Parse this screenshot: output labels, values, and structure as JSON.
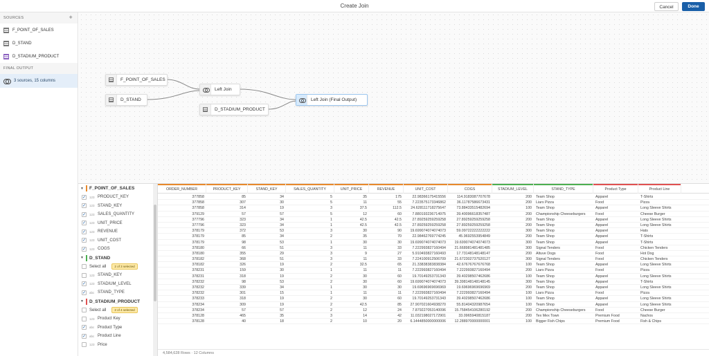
{
  "header": {
    "title": "Create Join",
    "cancel_label": "Cancel",
    "done_label": "Done"
  },
  "sidebar": {
    "sources_label": "SOURCES",
    "add_icon": "plus-icon",
    "sources": [
      {
        "label": "F_POINT_OF_SALES"
      },
      {
        "label": "D_STAND"
      },
      {
        "label": "D_STADIUM_PRODUCT"
      }
    ],
    "final_output_label": "FINAL OUTPUT",
    "final_output_item": "3 sources, 15 columns"
  },
  "canvas": {
    "nodes": {
      "f_point_of_sales": "F_POINT_OF_SALES",
      "d_stand": "D_STAND",
      "left_join": "Left Join",
      "d_stadium_product": "D_STADIUM_PRODUCT",
      "final": "Left Join (Final Output)"
    }
  },
  "fields_panel": {
    "groups": [
      {
        "name": "F_POINT_OF_SALES",
        "color": "#e8892b",
        "select_all": "",
        "badge": "",
        "fields": [
          {
            "type": "123",
            "label": "PRODUCT_KEY",
            "checked": true
          },
          {
            "type": "123",
            "label": "STAND_KEY",
            "checked": true
          },
          {
            "type": "123",
            "label": "SALES_QUANTITY",
            "checked": true
          },
          {
            "type": "123",
            "label": "UNIT_PRICE",
            "checked": true
          },
          {
            "type": "123",
            "label": "REVENUE",
            "checked": true
          },
          {
            "type": "123",
            "label": "UNIT_COST",
            "checked": true
          },
          {
            "type": "123",
            "label": "COGS",
            "checked": true
          }
        ]
      },
      {
        "name": "D_STAND",
        "color": "#4caf50",
        "select_all": "Select all",
        "badge": "2 of 3 selected",
        "fields": [
          {
            "type": "123",
            "label": "STAND_KEY",
            "checked": false
          },
          {
            "type": "123",
            "label": "STADIUM_LEVEL",
            "checked": true
          },
          {
            "type": "abc",
            "label": "STAND_TYPE",
            "checked": true
          }
        ]
      },
      {
        "name": "D_STADIUM_PRODUCT",
        "color": "#e05050",
        "select_all": "Select all",
        "badge": "2 of 4 selected",
        "fields": [
          {
            "type": "123",
            "label": "Product Key",
            "checked": false
          },
          {
            "type": "abc",
            "label": "Product Type",
            "checked": true
          },
          {
            "type": "abc",
            "label": "Product Line",
            "checked": true
          },
          {
            "type": "123",
            "label": "Price",
            "checked": false
          }
        ]
      }
    ]
  },
  "grid": {
    "columns": [
      {
        "label": "ORDER_NUMBER",
        "color": "#e8892b"
      },
      {
        "label": "PRODUCT_KEY",
        "color": "#e8892b"
      },
      {
        "label": "STAND_KEY",
        "color": "#e8892b"
      },
      {
        "label": "SALES_QUANTITY",
        "color": "#e8892b"
      },
      {
        "label": "UNIT_PRICE",
        "color": "#e8892b"
      },
      {
        "label": "REVENUE",
        "color": "#e8892b"
      },
      {
        "label": "UNIT_COST",
        "color": "#e8892b"
      },
      {
        "label": "COGS",
        "color": "#e8892b"
      },
      {
        "label": "STADIUM_LEVEL",
        "color": "#4caf50"
      },
      {
        "label": "STAND_TYPE",
        "color": "#4caf50"
      },
      {
        "label": "Product Type",
        "color": "#e05050"
      },
      {
        "label": "Product Line",
        "color": "#e05050"
      }
    ],
    "rows": [
      [
        "377858",
        "85",
        "34",
        "5",
        "35",
        "175",
        "22.98366175415556",
        "114.9183087707678",
        "200",
        "Team Shop",
        "Apparel",
        "T-Shirts"
      ],
      [
        "377858",
        "307",
        "30",
        "5",
        "11",
        "55",
        "7.223575173346862",
        "36.11787586673431",
        "200",
        "Liars Pizza",
        "Food",
        "Pizza"
      ],
      [
        "377858",
        "314",
        "19",
        "3",
        "37.5",
        "112.5",
        "24.628111718275647",
        "73.88433515482694",
        "100",
        "Team Shop",
        "Apparel",
        "Long Sleeve Shirts"
      ],
      [
        "379129",
        "57",
        "57",
        "5",
        "12",
        "60",
        "7.880193236714975",
        "39.40096618357487",
        "200",
        "Championship Cheeseburgers",
        "Food",
        "Cheese Burger"
      ],
      [
        "377796",
        "323",
        "34",
        "1",
        "42.5",
        "42.5",
        "27.89259259259258",
        "27.89259259259258",
        "200",
        "Team Shop",
        "Apparel",
        "Long Sleeve Shirts"
      ],
      [
        "377796",
        "323",
        "34",
        "1",
        "42.5",
        "42.5",
        "27.89259259259258",
        "27.89259259259258",
        "200",
        "Team Shop",
        "Apparel",
        "Long Sleeve Shirts"
      ],
      [
        "378179",
        "372",
        "53",
        "3",
        "30",
        "90",
        "19.699074074074073",
        "59.09722222222222",
        "300",
        "Team Shop",
        "Apparel",
        "Hats"
      ],
      [
        "378179",
        "85",
        "34",
        "2",
        "35",
        "70",
        "22.98462769774245",
        "45.9692553954849",
        "200",
        "Team Shop",
        "Apparel",
        "T-Shirts"
      ],
      [
        "378179",
        "98",
        "53",
        "1",
        "30",
        "30",
        "19.699074074074073",
        "19.699074074074073",
        "300",
        "Team Shop",
        "Apparel",
        "T-Shirts"
      ],
      [
        "378180",
        "66",
        "51",
        "3",
        "11",
        "33",
        "7.222993827160494",
        "21.668981481481485",
        "300",
        "Signal Tenders",
        "Food",
        "Chicken Tenders"
      ],
      [
        "378180",
        "355",
        "29",
        "3",
        "9",
        "27",
        "5.910493827160493",
        "17.73148148148147",
        "200",
        "Altuve Dogs",
        "Food",
        "Hot Dog"
      ],
      [
        "378182",
        "368",
        "51",
        "3",
        "11",
        "33",
        "7.224100912506709",
        "21.672302737520127",
        "300",
        "Signal Tenders",
        "Food",
        "Chicken Tenders"
      ],
      [
        "378182",
        "326",
        "19",
        "2",
        "32.5",
        "65",
        "21.33838383838384",
        "42.67676767676768",
        "100",
        "Team Shop",
        "Apparel",
        "Long Sleeve Shirts"
      ],
      [
        "378231",
        "159",
        "30",
        "1",
        "11",
        "11",
        "7.222993827160494",
        "7.222993827160494",
        "200",
        "Liars Pizza",
        "Food",
        "Pizza"
      ],
      [
        "378231",
        "318",
        "19",
        "2",
        "30",
        "60",
        "19.70149253731343",
        "39.40298507462686",
        "100",
        "Team Shop",
        "Apparel",
        "Long Sleeve Shirts"
      ],
      [
        "378232",
        "98",
        "53",
        "2",
        "30",
        "60",
        "19.699074074074073",
        "39.398148148148145",
        "300",
        "Team Shop",
        "Apparel",
        "T-Shirts"
      ],
      [
        "378232",
        "339",
        "34",
        "1",
        "30",
        "30",
        "19.69696969696969",
        "19.69696969696969",
        "200",
        "Team Shop",
        "Apparel",
        "Long Sleeve Shirts"
      ],
      [
        "378232",
        "301",
        "15",
        "1",
        "11",
        "11",
        "7.222993827160494",
        "7.222993827160494",
        "100",
        "Liars Pizza",
        "Food",
        "Pizza"
      ],
      [
        "378233",
        "318",
        "19",
        "2",
        "30",
        "60",
        "19.70149253731343",
        "39.40298507462686",
        "100",
        "Team Shop",
        "Apparel",
        "Long Sleeve Shirts"
      ],
      [
        "378234",
        "309",
        "19",
        "2",
        "42.5",
        "85",
        "27.907021604938270",
        "55.81404320987654",
        "100",
        "Team Shop",
        "Apparel",
        "Long Sleeve Shirts"
      ],
      [
        "378234",
        "57",
        "57",
        "2",
        "12",
        "24",
        "7.879227053140096",
        "15.758454106280192",
        "200",
        "Championship Cheeseburgers",
        "Food",
        "Cheese Burger"
      ],
      [
        "378128",
        "465",
        "35",
        "3",
        "14",
        "42",
        "11.032198027172901",
        "33.0965940815187",
        "200",
        "Tex Mex Town",
        "Premium Food",
        "Nachos"
      ],
      [
        "378128",
        "40",
        "18",
        "2",
        "10",
        "20",
        "6.1444850000000006",
        "12.288970000000001",
        "100",
        "Bigger Fish Chips",
        "Premium Food",
        "Fish & Chips"
      ]
    ]
  },
  "footer": {
    "summary": "4,584,628 Rows · 12 Columns"
  }
}
